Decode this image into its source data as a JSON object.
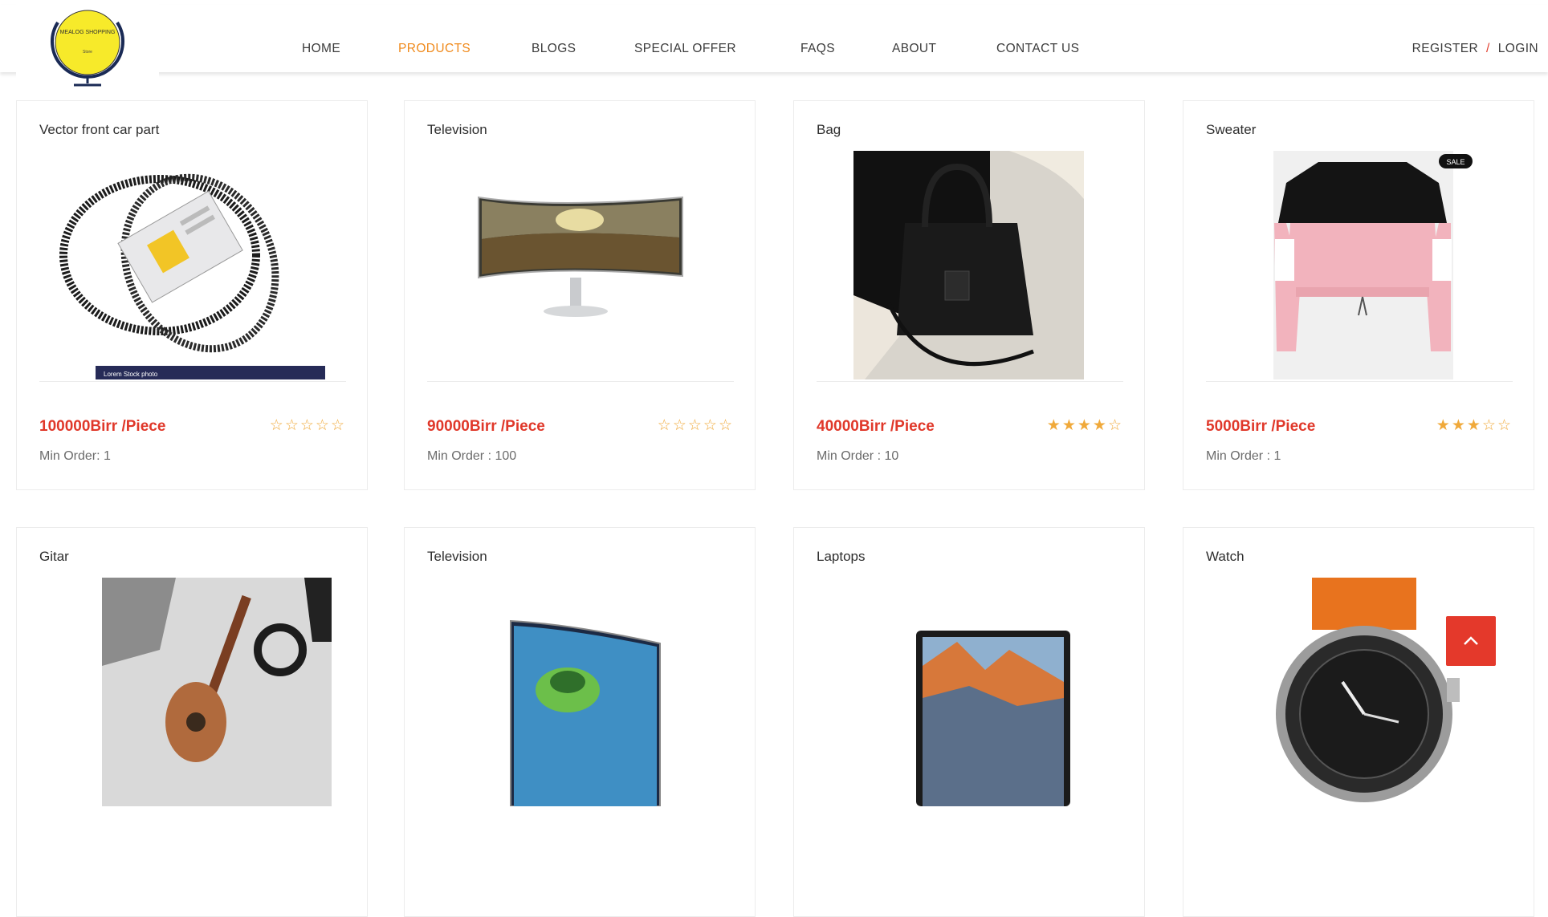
{
  "brand": {
    "logo_text": "MEALOG SHOPPING",
    "logo_tagline": "Store",
    "colors": {
      "accent": "#f08a1c",
      "price": "#e0382a",
      "star": "#f0a93a",
      "to_top": "#e4392b"
    }
  },
  "nav": {
    "items": [
      {
        "label": "HOME",
        "active": false
      },
      {
        "label": "PRODUCTS",
        "active": true
      },
      {
        "label": "BLOGS",
        "active": false
      },
      {
        "label": "SPECIAL OFFER",
        "active": false
      },
      {
        "label": "FAQS",
        "active": false
      },
      {
        "label": "ABOUT",
        "active": false
      },
      {
        "label": "CONTACT US",
        "active": false
      }
    ],
    "register": "REGISTER",
    "separator": "/",
    "login": "LOGIN"
  },
  "products": [
    {
      "title": "Vector front car part",
      "price": "100000Birr /Piece",
      "rating": 0,
      "min_order": "Min Order: 1",
      "image": "car-belt-image",
      "image_caption": "Lorem Stock photo"
    },
    {
      "title": "Television",
      "price": "90000Birr /Piece",
      "rating": 0,
      "min_order": "Min Order : 100",
      "image": "curved-monitor-image"
    },
    {
      "title": "Bag",
      "price": "40000Birr /Piece",
      "rating": 4,
      "min_order": "Min Order : 10",
      "image": "handbag-image"
    },
    {
      "title": "Sweater",
      "price": "5000Birr /Piece",
      "rating": 3,
      "min_order": "Min Order : 1",
      "image": "sweater-image",
      "image_badge": "SALE"
    },
    {
      "title": "Gitar",
      "image": "ukulele-image"
    },
    {
      "title": "Television",
      "image": "curved-tv-image"
    },
    {
      "title": "Laptops",
      "image": "laptop-image"
    },
    {
      "title": "Watch",
      "image": "smartwatch-image"
    }
  ],
  "scroll_top": {
    "icon": "chevron-up-icon"
  }
}
